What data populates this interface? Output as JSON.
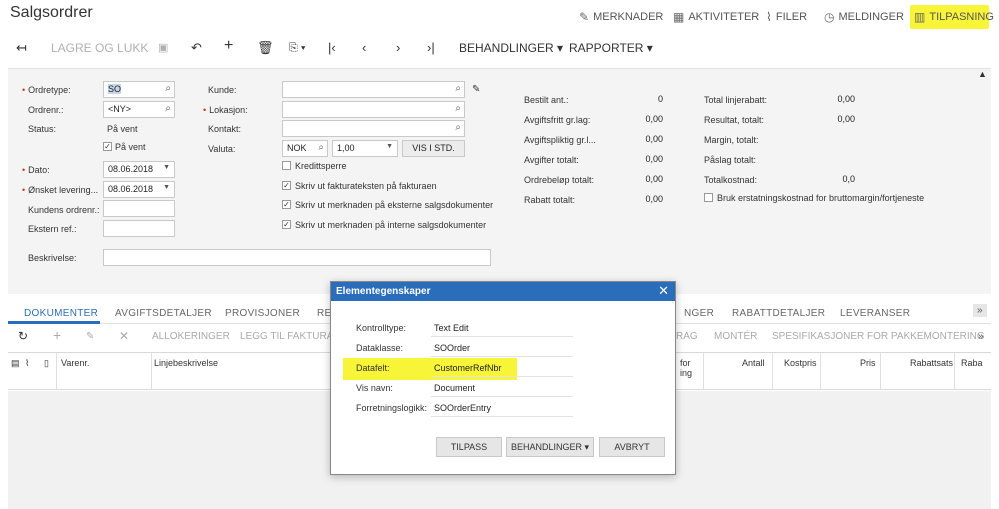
{
  "title": "Salgsordrer",
  "top_actions": [
    {
      "label": "MERKNADER",
      "icon": "edit-note-icon"
    },
    {
      "label": "AKTIVITETER",
      "icon": "calendar-icon"
    },
    {
      "label": "FILER",
      "icon": "paperclip-icon"
    },
    {
      "label": "MELDINGER",
      "icon": "alarm-clock-icon"
    },
    {
      "label": "TILPASNING",
      "icon": "chart-edit-icon"
    }
  ],
  "toolbar": {
    "save_close": "LAGRE OG LUKK",
    "actions": "BEHANDLINGER",
    "reports": "RAPPORTER"
  },
  "form": {
    "ordretype_label": "Ordretype:",
    "ordretype_value": "SO",
    "ordrenr_label": "Ordrenr.:",
    "ordrenr_value": "<NY>",
    "status_label": "Status:",
    "status_value": "På vent",
    "paa_vent_label": "På vent",
    "dato_label": "Dato:",
    "dato_value": "08.06.2018",
    "levering_label": "Ønsket levering...",
    "levering_value": "08.06.2018",
    "kundens_ordrenr_label": "Kundens ordrenr.:",
    "ekstern_ref_label": "Ekstern ref.:",
    "beskrivelse_label": "Beskrivelse:",
    "kunde_label": "Kunde:",
    "lokasjon_label": "Lokasjon:",
    "kontakt_label": "Kontakt:",
    "valuta_label": "Valuta:",
    "valuta_value": "NOK",
    "kurs_value": "1,00",
    "vis_std_button": "VIS I STD.",
    "kredittsperre_label": "Kredittsperre",
    "check1_label": "Skriv ut fakturateksten på fakturaen",
    "check2_label": "Skriv ut merknaden på eksterne salgsdokumenter",
    "check3_label": "Skriv ut merknaden på interne salgsdokumenter",
    "totals_mid": [
      {
        "label": "Bestilt ant.:",
        "value": "0"
      },
      {
        "label": "Avgiftsfritt gr.lag:",
        "value": "0,00"
      },
      {
        "label": "Avgiftspliktig gr.l...",
        "value": "0,00"
      },
      {
        "label": "Avgifter totalt:",
        "value": "0,00"
      },
      {
        "label": "Ordrebeløp totalt:",
        "value": "0,00"
      },
      {
        "label": "Rabatt totalt:",
        "value": "0,00"
      }
    ],
    "totals_right": [
      {
        "label": "Total linjerabatt:",
        "value": "0,00"
      },
      {
        "label": "Resultat, totalt:",
        "value": "0,00"
      },
      {
        "label": "Margin, totalt:",
        "value": ""
      },
      {
        "label": "Påslag totalt:",
        "value": ""
      },
      {
        "label": "Totalkostnad:",
        "value": "0,0"
      }
    ],
    "bruk_label": "Bruk erstatningskostnad for bruttomargin/fortjeneste"
  },
  "tabs": [
    "DOKUMENTER",
    "AVGIFTSDETALJER",
    "PROVISJONER",
    "RE",
    "NGER",
    "RABATTDETALJER",
    "LEVERANSER"
  ],
  "grid_toolbar": {
    "allokeringer": "ALLOKERINGER",
    "legg_til": "LEGG TIL FAKTURA",
    "rag": "RAG",
    "monter": "MONTÉR",
    "spesifikasjoner": "SPESIFIKASJONER FOR PAKKEMONTERING"
  },
  "grid_columns": {
    "varenr": "Varenr.",
    "linjebeskrivelse": "Linjebeskrivelse",
    "for_ing": "for\ning",
    "antall": "Antall",
    "kostpris": "Kostpris",
    "pris": "Pris",
    "rabattsats": "Rabattsats",
    "raba": "Raba"
  },
  "dialog": {
    "title": "Elementegenskaper",
    "rows": [
      {
        "label": "Kontrolltype:",
        "value": "Text Edit"
      },
      {
        "label": "Dataklasse:",
        "value": "SOOrder"
      },
      {
        "label": "Datafelt:",
        "value": "CustomerRefNbr"
      },
      {
        "label": "Vis navn:",
        "value": "Document"
      },
      {
        "label": "Forretningslogikk:",
        "value": "SOOrderEntry"
      }
    ],
    "btn_tilpass": "TILPASS",
    "btn_behandlinger": "BEHANDLINGER",
    "btn_avbryt": "AVBRYT"
  },
  "colors": {
    "accent": "#2a6ebb",
    "highlight": "#f8f538"
  }
}
